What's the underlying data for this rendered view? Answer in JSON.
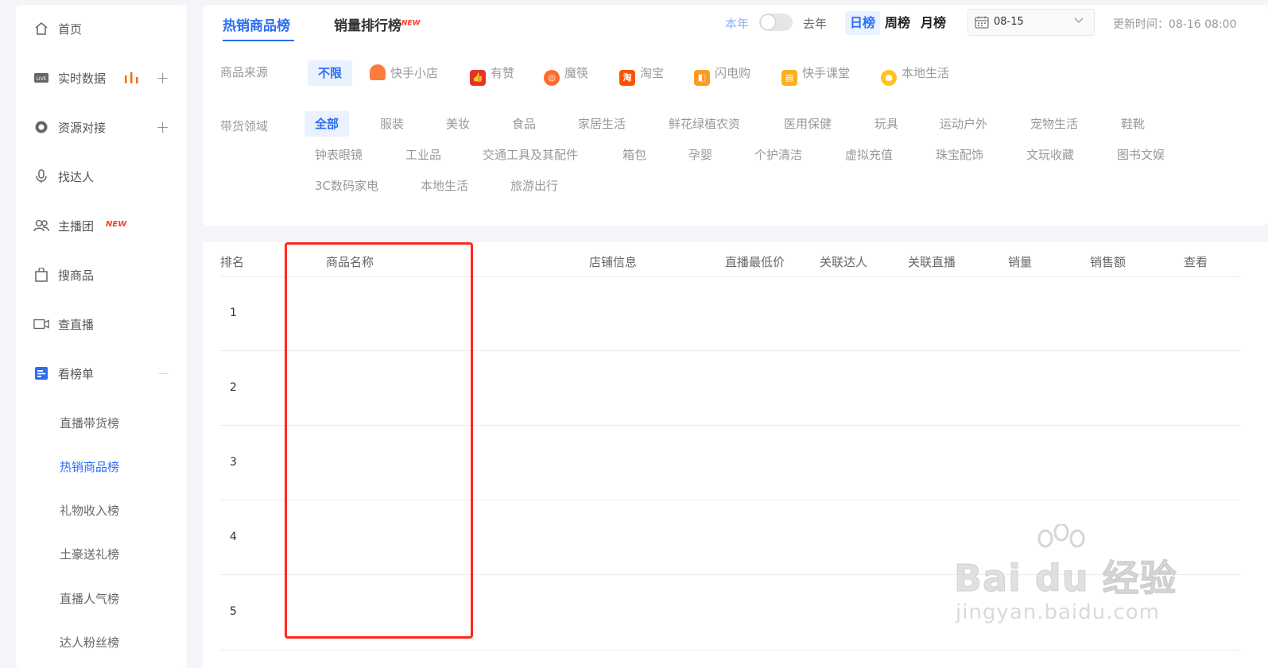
{
  "sidebar": {
    "items": [
      {
        "label": "首页",
        "icon": "home-icon"
      },
      {
        "label": "实时数据",
        "icon": "live-icon"
      },
      {
        "label": "资源对接",
        "icon": "connect-icon"
      },
      {
        "label": "找达人",
        "icon": "mic-icon"
      },
      {
        "label": "主播团",
        "icon": "group-icon",
        "badge": "NEW"
      },
      {
        "label": "搜商品",
        "icon": "bag-icon"
      },
      {
        "label": "查直播",
        "icon": "video-icon"
      },
      {
        "label": "看榜单",
        "icon": "list-icon"
      }
    ],
    "sub_items": [
      {
        "label": "直播带货榜"
      },
      {
        "label": "热销商品榜"
      },
      {
        "label": "礼物收入榜"
      },
      {
        "label": "土豪送礼榜"
      },
      {
        "label": "直播人气榜"
      },
      {
        "label": "达人粉丝榜"
      }
    ],
    "plus": "+",
    "minus": "—"
  },
  "tabs": [
    {
      "label": "热销商品榜"
    },
    {
      "label": "销量排行榜",
      "badge": "NEW"
    }
  ],
  "year_toggle": {
    "left": "本年",
    "right": "去年"
  },
  "periods": [
    "日榜",
    "周榜",
    "月榜"
  ],
  "date": {
    "value": "08-15"
  },
  "update_time": "更新时间：08-16 08:00",
  "source_filter": {
    "label": "商品来源",
    "options": [
      {
        "label": "不限",
        "color": ""
      },
      {
        "label": "快手小店",
        "color": "#ff7a3d"
      },
      {
        "label": "有赞",
        "color": "#e5322d"
      },
      {
        "label": "魔筷",
        "color": "#ff6b2c"
      },
      {
        "label": "淘宝",
        "color": "#ff5000"
      },
      {
        "label": "闪电购",
        "color": "#ff9a1f"
      },
      {
        "label": "快手课堂",
        "color": "#ffb01f"
      },
      {
        "label": "本地生活",
        "color": "#ffc21f"
      }
    ]
  },
  "category_filter": {
    "label": "带货领域",
    "row1": [
      "全部",
      "服装",
      "美妆",
      "食品",
      "家居生活",
      "鲜花绿植农资",
      "医用保健",
      "玩具",
      "运动户外",
      "宠物生活",
      "鞋靴"
    ],
    "row2": [
      "钟表眼镜",
      "工业品",
      "交通工具及其配件",
      "箱包",
      "孕婴",
      "个护清洁",
      "虚拟充值",
      "珠宝配饰",
      "文玩收藏",
      "图书文娱"
    ],
    "row3": [
      "3C数码家电",
      "本地生活",
      "旅游出行"
    ]
  },
  "table": {
    "headers": [
      "排名",
      "商品名称",
      "店铺信息",
      "直播最低价",
      "关联达人",
      "关联直播",
      "销量",
      "销售额",
      "查看"
    ],
    "ranks": [
      "1",
      "2",
      "3",
      "4",
      "5"
    ]
  },
  "watermark": {
    "main": "Bai du 经验",
    "sub": "jingyan.baidu.com"
  },
  "colors": {
    "accent": "#2b6ef2",
    "highlight_box": "#ff2a1e",
    "new_badge": "#ff3b1f"
  }
}
